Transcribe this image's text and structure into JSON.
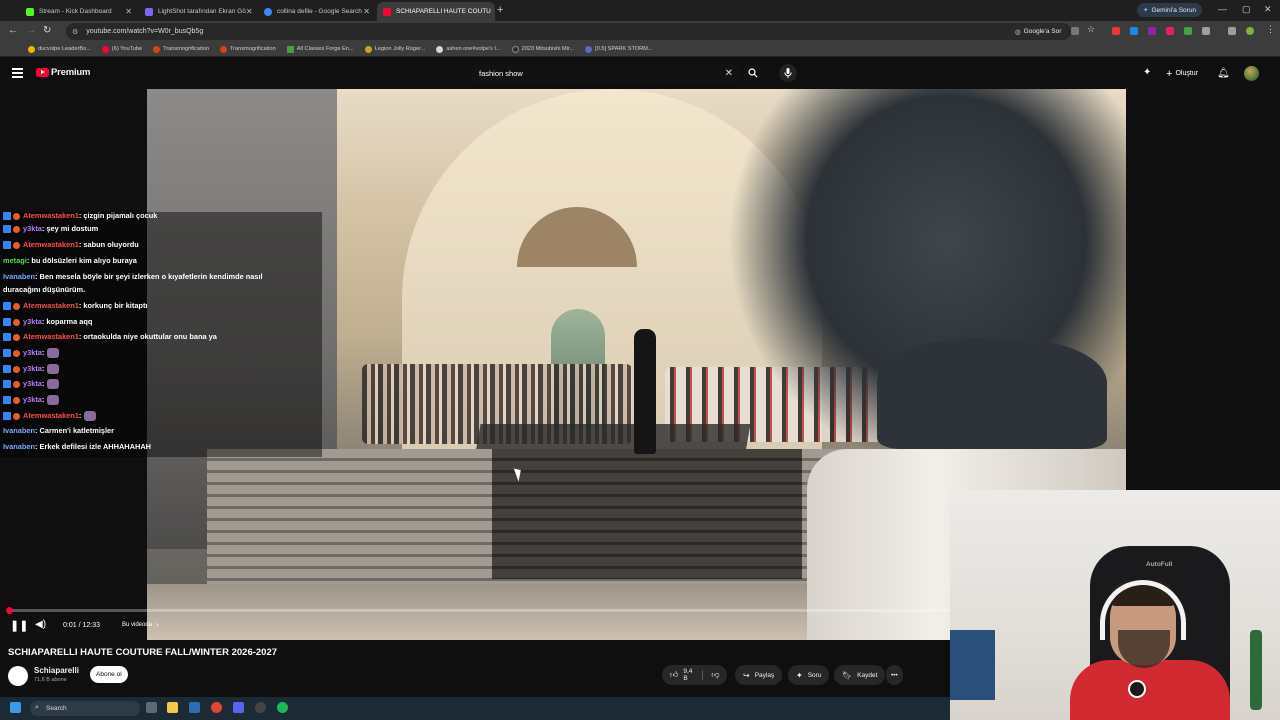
{
  "browser": {
    "tabs": [
      {
        "label": "Stream - Kick Dashboard",
        "color": "#53fc18"
      },
      {
        "label": "LightShot tarafından Ekran Gö",
        "color": "#7b68ee"
      },
      {
        "label": "collina defile - Google Search",
        "color": "#4285f4"
      },
      {
        "label": "SCHIAPARELLI HAUTE COUTU",
        "color": "#ff0033",
        "active": true
      }
    ],
    "gemini_label": "Gemini'a Sorun",
    "url": "youtube.com/watch?v=W0r_busQb5g",
    "google_sor": "Google'a Sor",
    "bookmarks": [
      "ducvolpe LeaderBo...",
      "(6) YouTube",
      "Transmogrification",
      "Transmogrification",
      "All Classes Forge En...",
      "Legion Jolly Roger...",
      "ashen one#volpe's I...",
      "2023 Mitsubishi Mir...",
      "[0.5] SPARK STORM..."
    ]
  },
  "youtube": {
    "logo_text": "Premium",
    "search_value": "fashion show",
    "create_label": "Oluştur"
  },
  "chat": {
    "messages": [
      {
        "user": "Atemwastaken1",
        "text": ": çizgin pijamalı çocuk",
        "color": "#ff4d4d",
        "badges": true
      },
      {
        "user": "y3kta",
        "text": ": şey mi dostum",
        "color": "#b57bff",
        "badges": true
      },
      {
        "user": "Atemwastaken1",
        "text": ": sabun oluyordu",
        "color": "#ff4d4d",
        "badges": true
      },
      {
        "user": "metagi",
        "text": ": bu dölsüzleri kim alıyo buraya",
        "color": "#5fd35f",
        "badges": false
      },
      {
        "user": "Ivanaben",
        "text": ": Ben mesela böyle bir şeyi izlerken o kıyafetlerin kendimde nasıl",
        "color": "#7aa6ff",
        "badges": false
      },
      {
        "user": "",
        "text": "duracağını düşünürüm.",
        "color": "#ffffff",
        "badges": false
      },
      {
        "user": "Atemwastaken1",
        "text": ": korkunç bir kitaptı",
        "color": "#ff4d4d",
        "badges": true
      },
      {
        "user": "y3kta",
        "text": ": koparma aqq",
        "color": "#b57bff",
        "badges": true
      },
      {
        "user": "Atemwastaken1",
        "text": ": ortaokulda niye okuttular onu bana ya",
        "color": "#ff4d4d",
        "badges": true
      },
      {
        "user": "y3kta",
        "text": ":",
        "color": "#b57bff",
        "badges": true,
        "emote": true
      },
      {
        "user": "y3kta",
        "text": ":",
        "color": "#b57bff",
        "badges": true,
        "emote": true
      },
      {
        "user": "y3kta",
        "text": ":",
        "color": "#b57bff",
        "badges": true,
        "emote": true
      },
      {
        "user": "y3kta",
        "text": ":",
        "color": "#b57bff",
        "badges": true,
        "emote": true
      },
      {
        "user": "Atemwastaken1",
        "text": ":",
        "color": "#ff4d4d",
        "badges": true,
        "emote": true
      },
      {
        "user": "Ivanaben",
        "text": ": Carmen'i katletmişler",
        "color": "#7aa6ff",
        "badges": false
      },
      {
        "user": "Ivanaben",
        "text": ": Erkek defilesi izle AHHAHAHAH",
        "color": "#7aa6ff",
        "badges": false
      }
    ]
  },
  "player": {
    "time": "0:01 / 12:33",
    "chapter": "Bu videoda",
    "progress": 0.003
  },
  "video": {
    "title": "SCHIAPARELLI HAUTE COUTURE FALL/WINTER 2026-2027",
    "channel": "Schiaparelli",
    "subscribers": "71,6 B abone",
    "subscribe_label": "Abone ol",
    "likes": "9,4 B",
    "share_label": "Paylaş",
    "ask_label": "Soru",
    "save_label": "Kaydet"
  },
  "taskbar": {
    "search_label": "Search"
  },
  "webcam": {
    "chair_brand": "AutoFull"
  }
}
